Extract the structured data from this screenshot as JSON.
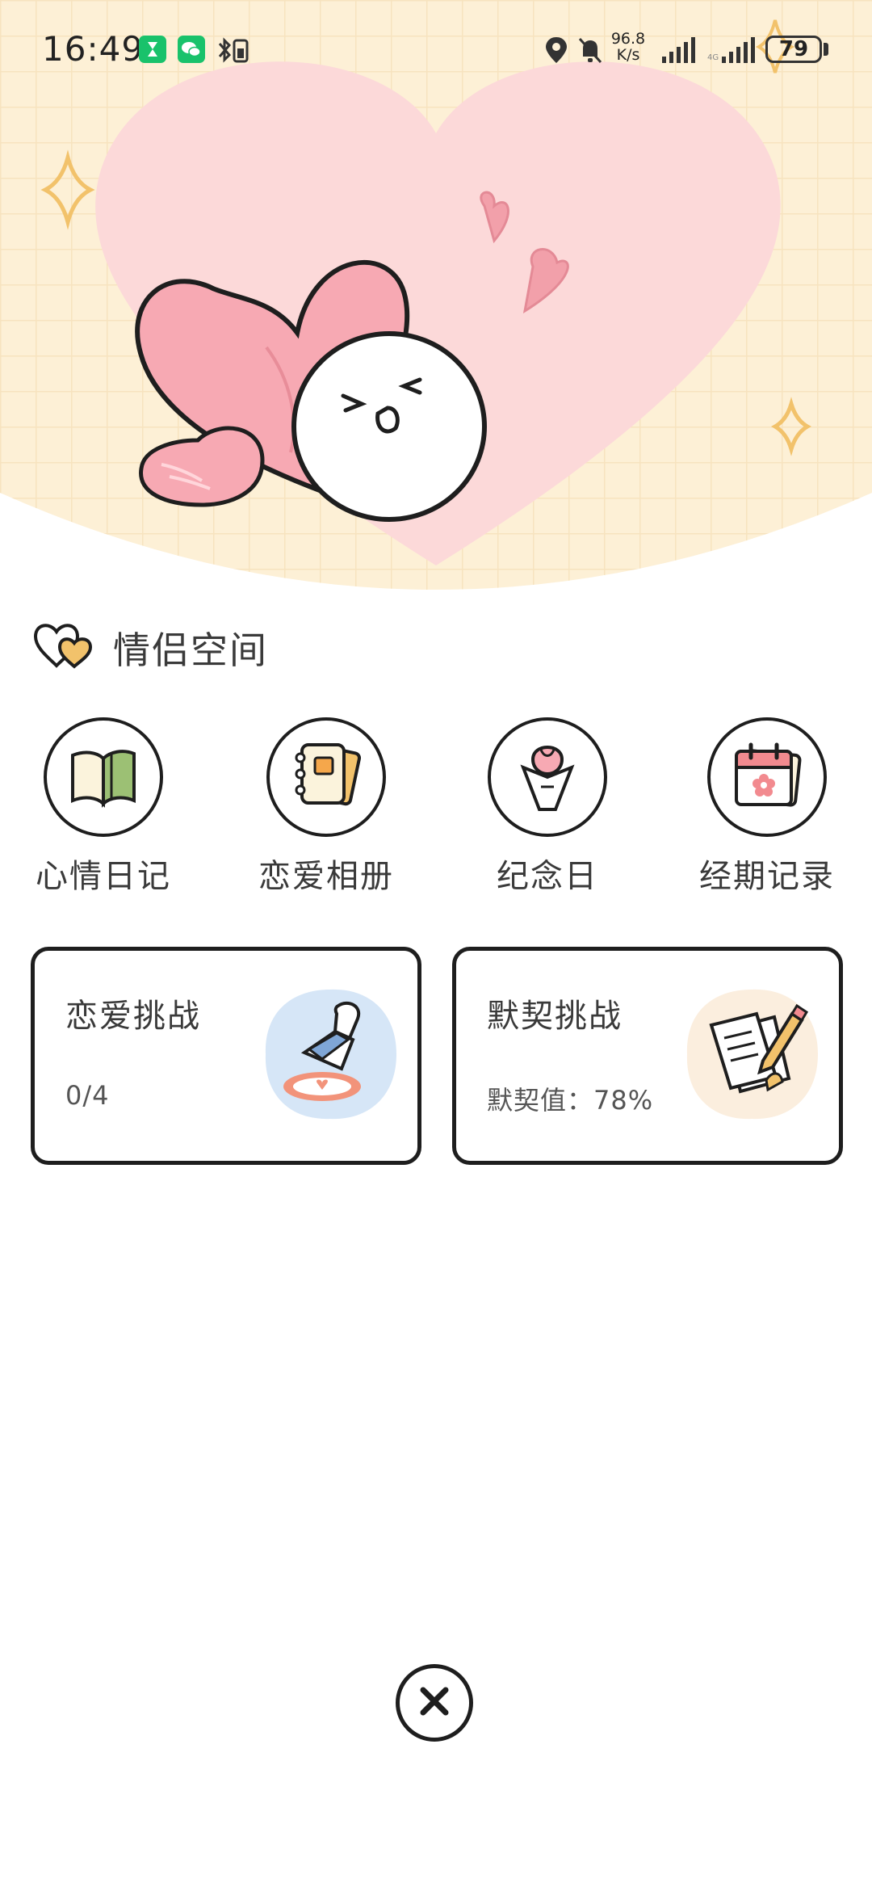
{
  "status_bar": {
    "time": "16:49",
    "net_speed_value": "96.8",
    "net_speed_unit": "K/s",
    "battery": "79"
  },
  "section": {
    "title": "情侣空间"
  },
  "features": [
    {
      "label": "心情日记",
      "icon": "open-book-icon"
    },
    {
      "label": "恋爱相册",
      "icon": "notebook-album-icon"
    },
    {
      "label": "纪念日",
      "icon": "flower-bouquet-icon"
    },
    {
      "label": "经期记录",
      "icon": "calendar-flower-icon"
    }
  ],
  "cards": [
    {
      "title": "恋爱挑战",
      "value": "0/4",
      "icon": "stamp-icon",
      "bg_color": "#d6e6f7"
    },
    {
      "title": "默契挑战",
      "value": "默契值：78%",
      "icon": "note-pencil-icon",
      "bg_color": "#fbeede"
    }
  ],
  "colors": {
    "hero_bg": "#fdf0d6",
    "heart_bg": "#fcd9d9",
    "pink_heart": "#f7a9b3",
    "accent_gold": "#f2c26b"
  }
}
